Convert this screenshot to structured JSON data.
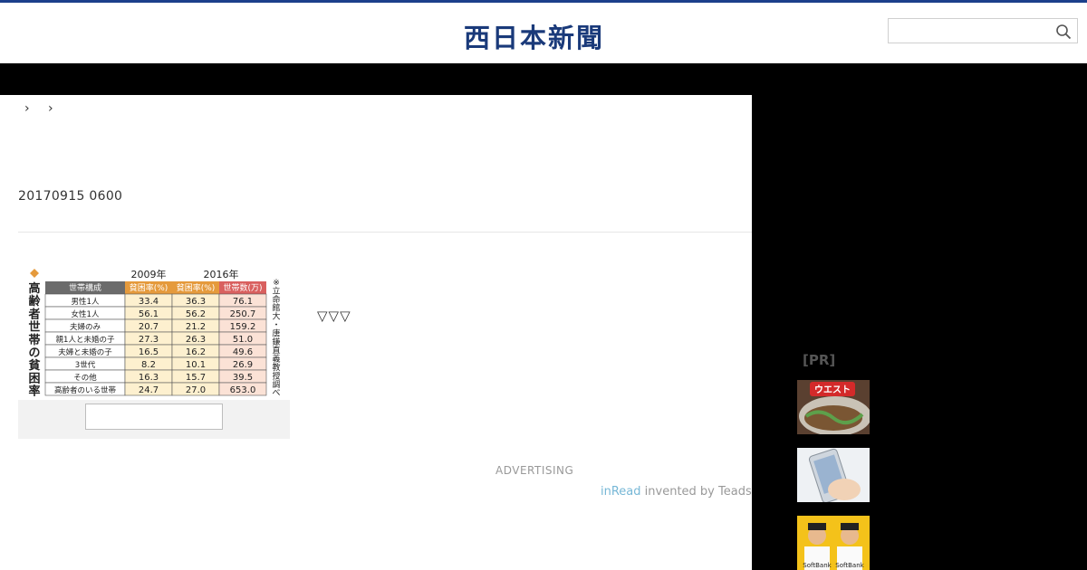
{
  "header": {
    "logo_text": "西日本新聞",
    "search": {
      "value": "",
      "placeholder": ""
    }
  },
  "breadcrumb": {
    "separators": [
      "›",
      "›"
    ]
  },
  "article": {
    "date": "20170915 0600",
    "body_symbols": "▽▽▽",
    "figure": {
      "title_vertical": "高齢者世帯の貧困率",
      "year_headers": [
        "2009年",
        "2016年"
      ],
      "columns": [
        "世帯構成",
        "貧困率(%)",
        "貧困率(%)",
        "世帯数(万)"
      ],
      "rows": [
        [
          "男性1人",
          "33.4",
          "36.3",
          "76.1"
        ],
        [
          "女性1人",
          "56.1",
          "56.2",
          "250.7"
        ],
        [
          "夫婦のみ",
          "20.7",
          "21.2",
          "159.2"
        ],
        [
          "親1人と未婚の子",
          "27.3",
          "26.3",
          "51.0"
        ],
        [
          "夫婦と未婚の子",
          "16.5",
          "16.2",
          "49.6"
        ],
        [
          "3世代",
          "8.2",
          "10.1",
          "26.9"
        ],
        [
          "その他",
          "16.3",
          "15.7",
          "39.5"
        ],
        [
          "高齢者のいる世帯",
          "24.7",
          "27.0",
          "653.0"
        ]
      ],
      "source_note": "※立命館大・唐鎌直義教授調べ",
      "caption": ""
    }
  },
  "ads": {
    "advertising_label": "ADVERTISING",
    "inread": "inRead",
    "invented_by": " invented by Teads"
  },
  "sidebar": {
    "pr_label": "[PR]",
    "thumbnails": [
      {
        "icon": "udon-bowl-ad-image",
        "badge": "ウエスト"
      },
      {
        "icon": "smartphone-hand-ad-image"
      },
      {
        "icon": "softbank-players-ad-image",
        "badge": "SoftBank"
      }
    ]
  },
  "colors": {
    "brand": "#1a3a7a",
    "topline": "#1c3f8b",
    "table_header_gray": "#6b6b6b",
    "table_header_orange": "#e59a3c",
    "table_header_red": "#d9605f"
  }
}
